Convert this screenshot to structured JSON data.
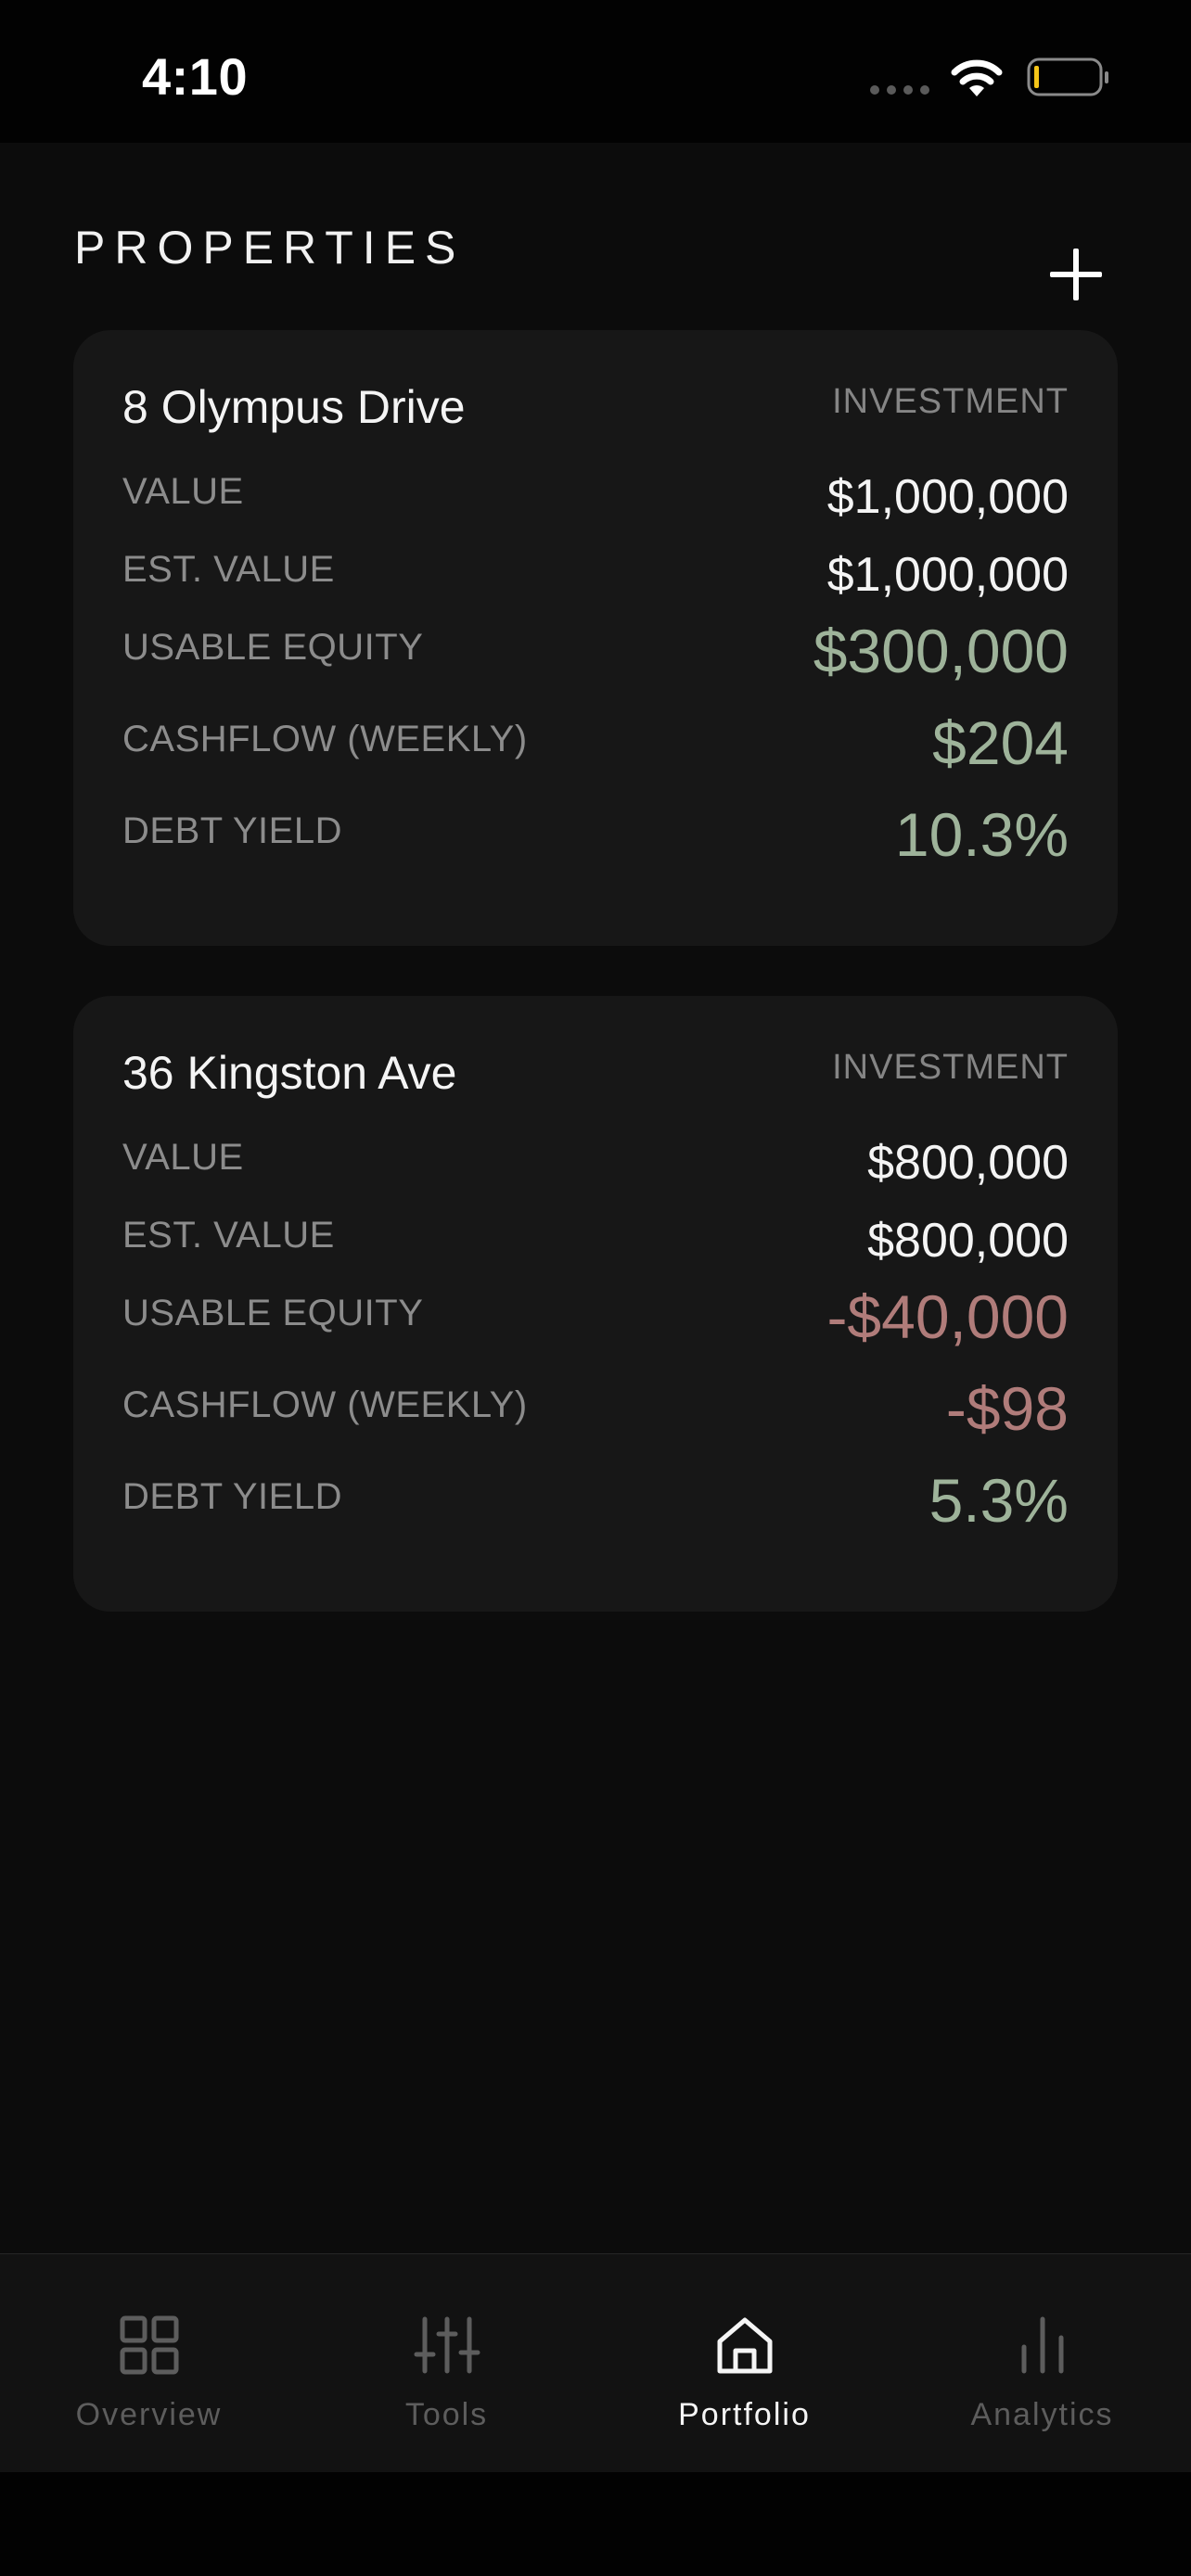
{
  "status_bar": {
    "time": "4:10"
  },
  "header": {
    "title": "PROPERTIES",
    "add_icon": "plus-icon"
  },
  "properties": [
    {
      "name": "8 Olympus Drive",
      "type": "INVESTMENT",
      "value_label": "VALUE",
      "value": "$1,000,000",
      "est_value_label": "EST. VALUE",
      "est_value": "$1,000,000",
      "usable_equity_label": "USABLE EQUITY",
      "usable_equity": "$300,000",
      "cashflow_label": "CASHFLOW (WEEKLY)",
      "cashflow": "$204",
      "debt_yield_label": "DEBT YIELD",
      "debt_yield": "10.3%"
    },
    {
      "name": "36 Kingston Ave",
      "type": "INVESTMENT",
      "value_label": "VALUE",
      "value": "$800,000",
      "est_value_label": "EST. VALUE",
      "est_value": "$800,000",
      "usable_equity_label": "USABLE EQUITY",
      "usable_equity": "-$40,000",
      "cashflow_label": "CASHFLOW (WEEKLY)",
      "cashflow": "-$98",
      "debt_yield_label": "DEBT YIELD",
      "debt_yield": "5.3%"
    }
  ],
  "tab_bar": {
    "tabs": [
      {
        "label": "Overview",
        "icon": "grid-icon"
      },
      {
        "label": "Tools",
        "icon": "sliders-icon"
      },
      {
        "label": "Portfolio",
        "icon": "home-icon",
        "active": true
      },
      {
        "label": "Analytics",
        "icon": "bar-chart-icon"
      }
    ]
  },
  "colors": {
    "positive": "#9eb39a",
    "negative": "#b07c7a",
    "card_bg": "#171717",
    "page_bg": "#0c0c0c"
  }
}
